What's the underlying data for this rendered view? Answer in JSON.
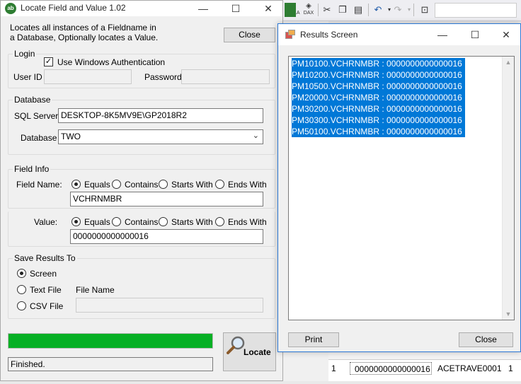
{
  "background_app": {
    "toolbar_icons": [
      "xmla-icon",
      "dax-icon",
      "cut-icon",
      "copy-icon",
      "paste-icon",
      "undo-icon",
      "redo-icon",
      "properties-icon"
    ],
    "toolbar_text": {
      "xmla": "XMLA",
      "dax": "DAX"
    },
    "grid": {
      "row_number": "1",
      "value": "0000000000000016",
      "vendor": "ACETRAVE0001",
      "count": "1"
    }
  },
  "main_window": {
    "title": "Locate Field and Value 1.02",
    "description": "Locates all instances of a Fieldname in a Database, Optionally locates a Value.",
    "close_label": "Close",
    "login": {
      "legend": "Login",
      "use_windows_auth_label": "Use Windows Authentication",
      "use_windows_auth_checked": true,
      "user_id_label": "User ID",
      "user_id_value": "",
      "password_label": "Password",
      "password_value": ""
    },
    "database": {
      "legend": "Database",
      "sql_server_label": "SQL Server",
      "sql_server_value": "DESKTOP-8K5MV9E\\GP2018R2",
      "database_label": "Database",
      "database_value": "TWO"
    },
    "field_info": {
      "legend": "Field Info",
      "field_name_label": "Field Name:",
      "match_options": [
        "Equals",
        "Contains",
        "Starts With",
        "Ends With"
      ],
      "field_match_selected": "Equals",
      "field_name_value": "VCHRNMBR",
      "value_label": "Value:",
      "value_match_selected": "Equals",
      "value_value": "0000000000000016"
    },
    "save_results": {
      "legend": "Save Results To",
      "screen_label": "Screen",
      "text_file_label": "Text File",
      "csv_file_label": "CSV File",
      "selected": "Screen",
      "file_name_label": "File Name",
      "file_name_value": ""
    },
    "progress_percent": 100,
    "status_text": "Finished.",
    "locate_label": "Locate"
  },
  "results_window": {
    "title": "Results Screen",
    "lines": [
      "PM10100.VCHRNMBR : 0000000000000016",
      "PM10200.VCHRNMBR : 0000000000000016",
      "PM10500.VCHRNMBR : 0000000000000016",
      "PM20000.VCHRNMBR : 0000000000000016",
      "PM30200.VCHRNMBR : 0000000000000016",
      "PM30300.VCHRNMBR : 0000000000000016",
      "PM50100.VCHRNMBR : 0000000000000016"
    ],
    "print_label": "Print",
    "close_label": "Close"
  },
  "colors": {
    "progress": "#06b025",
    "selection": "#0078d7",
    "window_bg": "#f0f0f0"
  }
}
